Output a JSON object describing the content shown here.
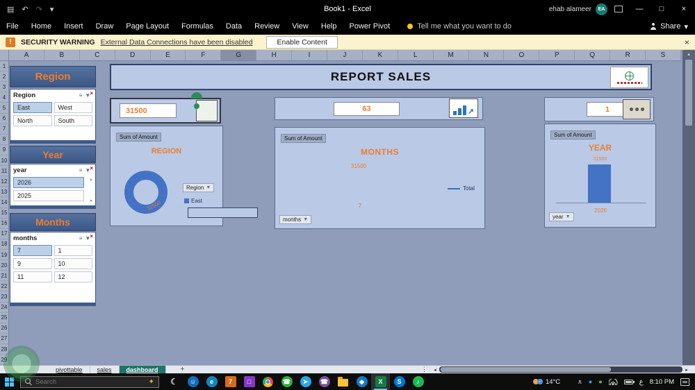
{
  "title_bar": {
    "title": "Book1  -  Excel",
    "user": "ehab alameer",
    "user_initials": "EA"
  },
  "ribbon": {
    "tabs": [
      "File",
      "Home",
      "Insert",
      "Draw",
      "Page Layout",
      "Formulas",
      "Data",
      "Review",
      "View",
      "Help",
      "Power Pivot"
    ],
    "tell_me": "Tell me what you want to do",
    "share_label": "Share"
  },
  "security_bar": {
    "label": "SECURITY WARNING",
    "message": "External Data Connections have been disabled",
    "button_label": "Enable Content"
  },
  "grid": {
    "columns": [
      "A",
      "B",
      "C",
      "D",
      "E",
      "F",
      "G",
      "H",
      "I",
      "J",
      "K",
      "L",
      "M",
      "N",
      "O",
      "P",
      "Q",
      "R",
      "S"
    ],
    "selected_column": "G",
    "rows": [
      "1",
      "2",
      "3",
      "4",
      "5",
      "6",
      "7",
      "8",
      "9",
      "10",
      "11",
      "12",
      "13",
      "14",
      "15",
      "16",
      "17",
      "18",
      "19",
      "20",
      "21",
      "22",
      "23",
      "24",
      "25",
      "26",
      "27",
      "28",
      "29"
    ]
  },
  "dashboard": {
    "title": "REPORT SALES",
    "slicers": [
      {
        "title": "Region",
        "header": "Region",
        "items": [
          "East",
          "West",
          "North",
          "South"
        ],
        "selected": "East"
      },
      {
        "title": "Year",
        "header": "year",
        "items": [
          "2026",
          "2025"
        ],
        "selected": "2026"
      },
      {
        "title": "Months",
        "header": "months",
        "items": [
          "7",
          "1",
          "9",
          "10",
          "11",
          "12"
        ],
        "selected": "7"
      }
    ],
    "kpis": [
      {
        "value": "31500"
      },
      {
        "value": "63"
      },
      {
        "value": "1"
      }
    ],
    "charts": [
      {
        "field_button": "Sum of Amount",
        "title": "REGION",
        "value_label": "31500",
        "filter_button": "Region",
        "legend": "East"
      },
      {
        "field_button": "Sum of Amount",
        "title": "MONTHS",
        "value_label": "31500",
        "filter_button": "months",
        "legend": "Total",
        "x_label": "7"
      },
      {
        "field_button": "Sum of Amount",
        "title": "YEAR",
        "value_label": "31500",
        "filter_button": "year",
        "x_label": "2026"
      }
    ]
  },
  "chart_data": [
    {
      "type": "pie",
      "title": "REGION",
      "categories": [
        "East"
      ],
      "values": [
        31500
      ],
      "legend": [
        "East"
      ]
    },
    {
      "type": "line",
      "title": "MONTHS",
      "x": [
        "7"
      ],
      "series": [
        {
          "name": "Total",
          "values": [
            31500
          ]
        }
      ]
    },
    {
      "type": "bar",
      "title": "YEAR",
      "categories": [
        "2026"
      ],
      "values": [
        31500
      ]
    }
  ],
  "sheet_tabs": {
    "tabs": [
      "pivottable",
      "sales",
      "dashboard"
    ],
    "active": "dashboard"
  },
  "taskbar": {
    "search_placeholder": "Search",
    "weather": "14°C",
    "language": "ع",
    "time": "8:10 PM",
    "icons": [
      {
        "name": "night-mode-icon",
        "glyph": "☾",
        "shape": "plain",
        "bg": "",
        "fg": "#cfcfcf"
      },
      {
        "name": "people-icon",
        "glyph": "☺",
        "shape": "round",
        "bg": "#0F6CBD",
        "fg": "#ffffff"
      },
      {
        "name": "edge-icon",
        "glyph": "e",
        "shape": "round",
        "bg": "#0E88C3",
        "fg": "#ffffff"
      },
      {
        "name": "calendar-icon",
        "glyph": "7",
        "shape": "square",
        "bg": "#D86A1A",
        "fg": "#ffffff"
      },
      {
        "name": "store-icon",
        "glyph": "□",
        "shape": "square",
        "bg": "#8637C8",
        "fg": "#ffffff"
      },
      {
        "name": "chrome-icon",
        "glyph": "",
        "shape": "chrome",
        "bg": "",
        "fg": ""
      },
      {
        "name": "whatsapp-icon",
        "glyph": "☎",
        "shape": "round",
        "bg": "#23B33A",
        "fg": "#ffffff"
      },
      {
        "name": "telegram-icon",
        "glyph": "➤",
        "shape": "round",
        "bg": "#27A7E7",
        "fg": "#ffffff"
      },
      {
        "name": "viber-icon",
        "glyph": "☎",
        "shape": "round",
        "bg": "#7B519D",
        "fg": "#ffffff"
      },
      {
        "name": "file-explorer-icon",
        "glyph": "",
        "shape": "folder",
        "bg": "",
        "fg": ""
      },
      {
        "name": "browser-icon",
        "glyph": "◆",
        "shape": "round",
        "bg": "#1779C4",
        "fg": "#ffffff"
      },
      {
        "name": "excel-icon",
        "glyph": "X",
        "shape": "square",
        "bg": "#107C41",
        "fg": "#ffffff",
        "active": true
      },
      {
        "name": "skype-icon",
        "glyph": "S",
        "shape": "round",
        "bg": "#0078D4",
        "fg": "#ffffff"
      },
      {
        "name": "spotify-icon",
        "glyph": "♪",
        "shape": "round",
        "bg": "#1DB954",
        "fg": "#ffffff"
      }
    ]
  },
  "icons": {
    "save": "▤",
    "undo": "↶",
    "redo": "↷",
    "dropdown": "▾",
    "minimize": "—",
    "maximize": "□",
    "close": "×",
    "multiselect": "≡",
    "funnel": "▼",
    "funnel_x": "×",
    "up": "▴",
    "down": "▾",
    "left": "◂",
    "right": "▸",
    "new_sheet": "+",
    "menu_dots": "⋮",
    "caret_up": "∧",
    "dot": "●",
    "sparkle": "✦",
    "warning": "!"
  },
  "colors": {
    "accent_orange": "#ED7D31",
    "chart_blue": "#4472C4",
    "panel_blue": "#BAC9E6",
    "slicer_header_blue": "#46618F",
    "active_tab_teal": "#1E7569"
  }
}
